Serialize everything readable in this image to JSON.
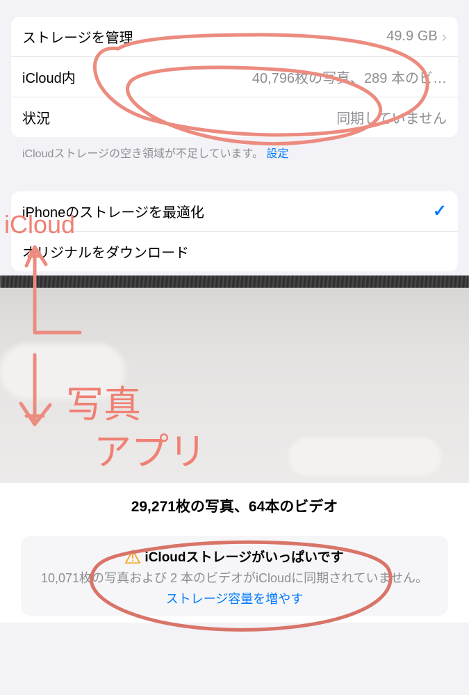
{
  "settings": {
    "rows": [
      {
        "label": "ストレージを管理",
        "value": "49.9 GB",
        "chevron": true
      },
      {
        "label": "iCloud内",
        "value": "40,796枚の写真、289 本のビ…"
      },
      {
        "label": "状況",
        "value": "同期していません"
      }
    ],
    "footer_text": "iCloudストレージの空き領域が不足しています。",
    "footer_link": "設定",
    "options": [
      {
        "label": "iPhoneのストレージを最適化",
        "checked": true
      },
      {
        "label": "オリジナルをダウンロード",
        "checked": false
      }
    ]
  },
  "photos_app": {
    "count_line": "29,271枚の写真、64本のビデオ",
    "warning_title": "iCloudストレージがいっぱいです",
    "warning_desc": "10,071枚の写真および 2 本のビデオがiCloudに同期されていません。",
    "warning_link": "ストレージ容量を増やす"
  },
  "annotations": {
    "top_label": "iCloud",
    "bottom_label_1": "写真",
    "bottom_label_2": "アプリ"
  }
}
